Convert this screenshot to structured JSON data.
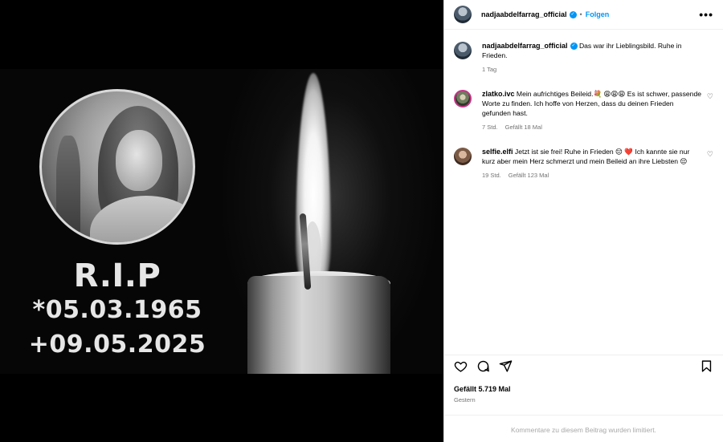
{
  "post": {
    "username": "nadjaabdelfarrag_official",
    "follow_label": "Folgen",
    "more_label": "•••",
    "caption": "Das war ihr Lieblingsbild. Ruhe in Frieden.",
    "caption_time": "1 Tag"
  },
  "image": {
    "title": "R.I.P",
    "birth": "*05.03.1965",
    "death": "+09.05.2025"
  },
  "comments": [
    {
      "username": "zlatko.ivc",
      "text": "Mein aufrichtiges Beileid.💐 😩😩😩 Es ist schwer, passende Worte zu finden. Ich hoffe von Herzen, dass du deinen Frieden gefunden hast.",
      "time": "7 Std.",
      "likes": "Gefällt 18 Mal"
    },
    {
      "username": "selfie.elfi",
      "text": "Jetzt ist sie frei! Ruhe in Frieden 😔 ❤️ Ich kannte sie nur kurz aber mein Herz schmerzt und mein Beileid an ihre Liebsten 😔",
      "time": "19 Std.",
      "likes": "Gefällt 123 Mal"
    }
  ],
  "footer": {
    "likes": "Gefällt 5.719 Mal",
    "date": "Gestern",
    "comments_limited": "Kommentare zu diesem Beitrag wurden limitiert."
  },
  "icons": {
    "like": "heart-icon",
    "comment": "comment-icon",
    "share": "share-icon",
    "save": "bookmark-icon"
  },
  "colors": {
    "accent": "#0095f6",
    "muted": "#737373",
    "limited_text": "#a8a8a8"
  }
}
